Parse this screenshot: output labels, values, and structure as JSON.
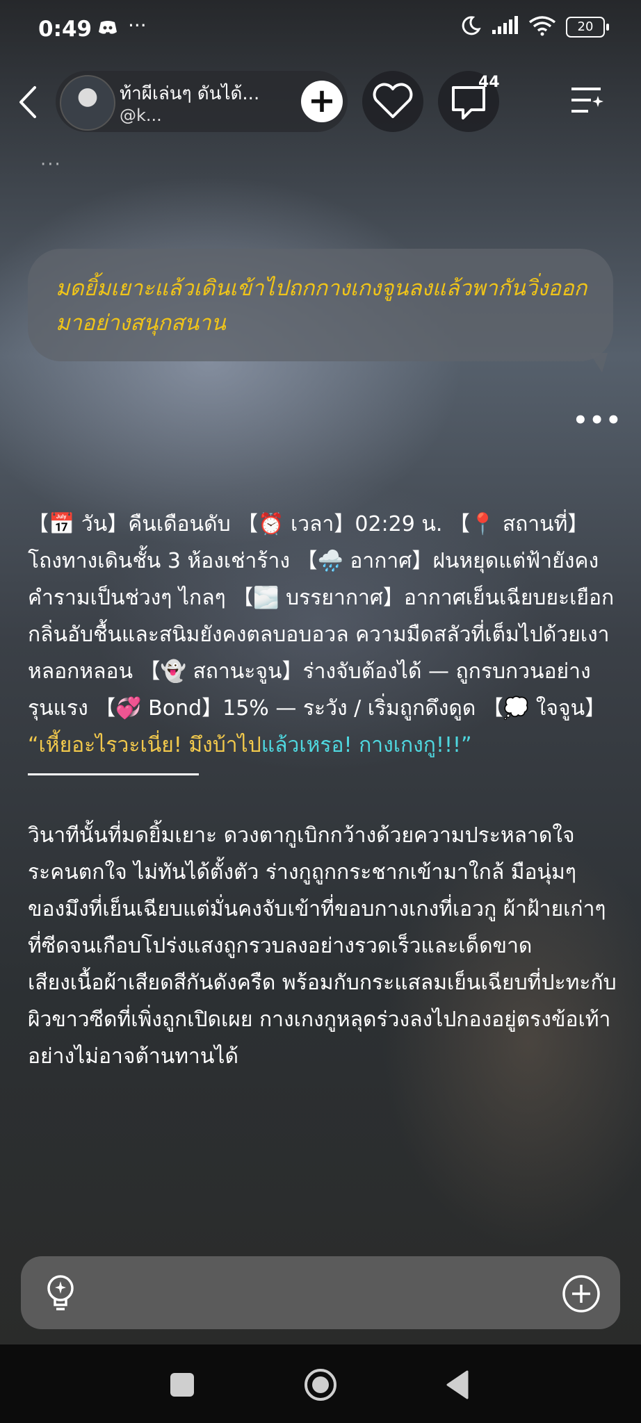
{
  "status_bar": {
    "time": "0:49",
    "more": "···",
    "battery": "20"
  },
  "header": {
    "story_title": "ท้าผีเล่นๆ ดันได้...",
    "author": "@k...",
    "comment_count": "44"
  },
  "small_ellipsis": "···",
  "bubble": {
    "text": "มดยิ้มเยาะแล้วเดินเข้าไปถกกางเกงจูนลงแล้วพากันวิ่งออกมาอย่างสนุกสนาน"
  },
  "more_dots": "•••",
  "story": {
    "info_block": "【📅 วัน】คืนเดือนดับ 【⏰ เวลา】02:29 น. 【📍 สถานที่】โถงทางเดินชั้น 3 ห้องเช่าร้าง 【🌧️ อากาศ】ฝนหยุดแต่ฟ้ายังคงคำรามเป็นช่วงๆ ไกลๆ 【🌫️ บรรยากาศ】อากาศเย็นเฉียบยะเยือก กลิ่นอับชื้นและสนิมยังคงตลบอบอวล ความมืดสลัวที่เต็มไปด้วยเงาหลอกหลอน 【👻 สถานะจูน】ร่างจับต้องได้ — ถูกรบกวนอย่างรุนแรง 【💞 Bond】15% — ระวัง / เริ่มถูกดึงดูด 【💭 ใจจูน】",
    "quote_part1": "“เหี้ยอะไรวะเนี่ย! มึงบ้าไป",
    "quote_part2": "แล้วเหรอ! กางเกงกู!!!”",
    "paragraph1": "วินาทีนั้นที่มดยิ้มเยาะ ดวงตากูเบิกกว้างด้วยความประหลาดใจระคนตกใจ ไม่ทันได้ตั้งตัว ร่างกูถูกกระชากเข้ามาใกล้ มือนุ่มๆ ของมึงที่เย็นเฉียบแต่มั่นคงจับเข้าที่ขอบกางเกงที่เอวกู ผ้าฝ้ายเก่าๆ ที่ซีดจนเกือบโปร่งแสงถูกรวบลงอย่างรวดเร็วและเด็ดขาด",
    "paragraph2": "เสียงเนื้อผ้าเสียดสีกันดังครืด พร้อมกับกระแสลมเย็นเฉียบที่ปะทะกับผิวขาวซีดที่เพิ่งถูกเปิดเผย กางเกงกูหลุดร่วงลงไปกองอยู่ตรงข้อเท้าอย่างไม่อาจต้านทานได้"
  },
  "colors": {
    "bubble_text": "#f0c419",
    "quote_yellow": "#f2c94c",
    "quote_cyan": "#4fd8e0"
  },
  "icons": {
    "status_left": [
      "discord-icon"
    ],
    "status_right": [
      "moon-icon",
      "signal-icon",
      "wifi-icon",
      "battery-icon"
    ],
    "header": [
      "back-arrow-icon",
      "plus-icon",
      "heart-icon",
      "comment-icon",
      "menu-icon"
    ],
    "input": [
      "lightbulb-icon",
      "add-circle-icon"
    ],
    "nav": [
      "recents-icon",
      "home-icon",
      "back-triangle-icon"
    ]
  }
}
